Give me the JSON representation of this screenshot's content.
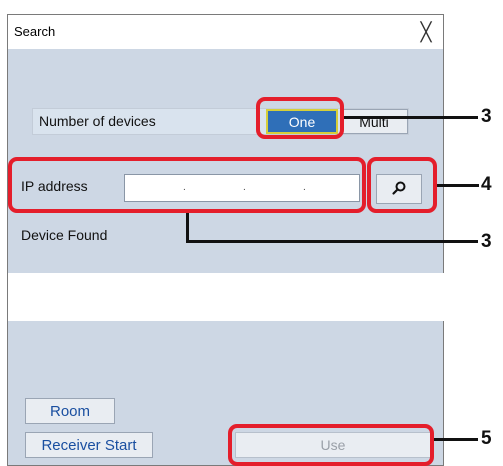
{
  "dialog": {
    "title": "Search",
    "close_glyph": "╳",
    "number_of_devices_label": "Number of devices",
    "one_label": "One",
    "multi_label": "Multi",
    "ip_label": "IP address",
    "ip_separator": ".",
    "device_found_label": "Device Found",
    "room_label": "Room",
    "receiver_start_label": "Receiver Start",
    "use_label": "Use",
    "search_icon": "search-icon"
  },
  "callouts": [
    "3",
    "4",
    "3",
    "5"
  ],
  "colors": {
    "callout": "#e41e2b",
    "dialog_bg": "#cdd7e4",
    "one_active": "#2f6fb8"
  }
}
